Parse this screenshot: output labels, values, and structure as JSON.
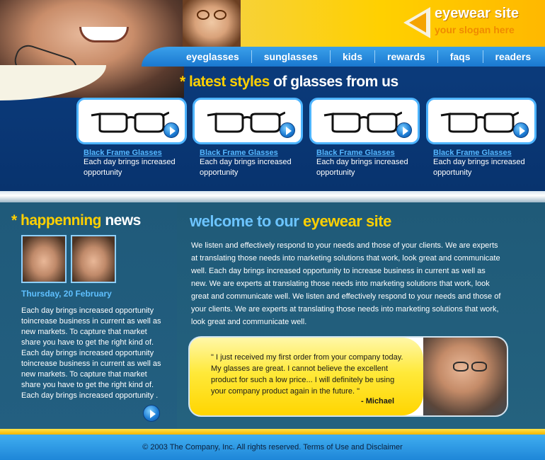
{
  "logo": {
    "title": "eyewear site",
    "slogan": "your slogan here"
  },
  "nav": [
    "eyeglasses",
    "sunglasses",
    "kids",
    "rewards",
    "faqs",
    "readers"
  ],
  "latest": {
    "prefix": "* latest styles",
    "suffix": " of glasses from us"
  },
  "products": [
    {
      "name": "Black Frame Glasses",
      "desc": "Each day brings increased opportunity"
    },
    {
      "name": "Black Frame Glasses",
      "desc": "Each day brings increased opportunity"
    },
    {
      "name": "Black Frame Glasses",
      "desc": "Each day brings increased opportunity"
    },
    {
      "name": "Black Frame Glasses",
      "desc": "Each day brings increased opportunity"
    }
  ],
  "news": {
    "title_prefix": "* happenning",
    "title_suffix": " news",
    "date": "Thursday, 20 February",
    "text": "Each day brings increased opportunity toincrease business in current as well as new markets. To capture that market share you have to get the right kind of. Each day brings increased opportunity toincrease business in current as well as new markets. To capture that market share you have to get the right kind of. Each day brings increased opportunity ."
  },
  "welcome": {
    "title_prefix": "welcome to our ",
    "title_suffix": "eyewear site",
    "text": "We listen and effectively respond to your needs and  those of your clients. We are experts at translating  those needs into marketing solutions that work, look great and communicate well. Each day brings increased opportunity to increase business in current as well as new. We are experts at translating those needs into marketing solutions that work, look great and communicate well. We listen and effectively respond to your needs and  those of your clients. We are experts at translating  those needs into marketing solutions that work, look great and communicate well."
  },
  "testimonial": {
    "quote": "\" I just received my first order from your company today. My glasses are great.  I cannot believe the excellent product for such a low price... I will definitely be using your company product again in the future. \"",
    "author": "- Michael"
  },
  "footer": {
    "text": "© 2003 The Company, Inc. All rights reserved. Terms of Use and Disclaimer"
  },
  "colors": {
    "accent_yellow": "#ffd000",
    "link_blue": "#55b7ff",
    "nav_blue": "#1a78d0"
  }
}
